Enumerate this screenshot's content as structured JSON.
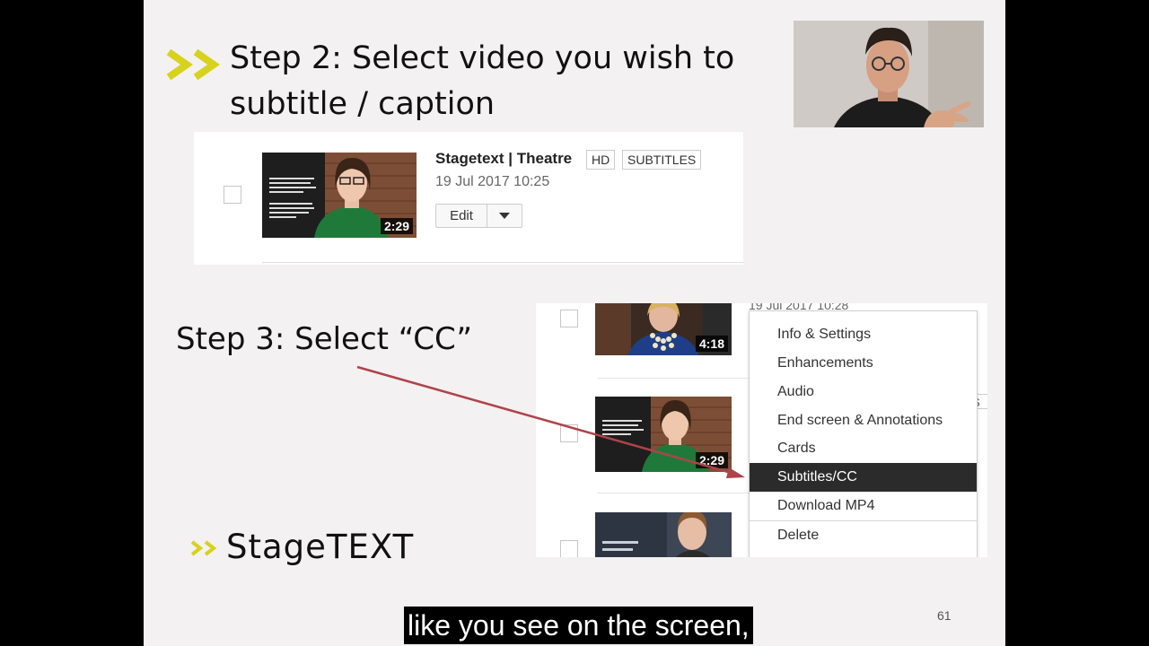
{
  "slide": {
    "step2_line1": "Step 2: Select video you wish to",
    "step2_line2": "subtitle / caption",
    "step3": "Step 3: Select “CC”",
    "page_number": "61",
    "logo_chevron": ">>",
    "logo_text": "StageTEXT"
  },
  "video_row": {
    "title": "Stagetext | Theatre",
    "badges": [
      "HD",
      "SUBTITLES"
    ],
    "date": "19 Jul 2017 10:25",
    "duration": "2:29",
    "edit_label": "Edit"
  },
  "video_list": {
    "clipped_date": "19 Jul 2017 10:28",
    "items": [
      {
        "duration": "4:18"
      },
      {
        "duration": "2:29"
      },
      {
        "duration": ""
      }
    ],
    "clipped_badge": "S"
  },
  "context_menu": {
    "items": [
      "Info & Settings",
      "Enhancements",
      "Audio",
      "End screen & Annotations",
      "Cards",
      "Subtitles/CC",
      "Download MP4",
      "Delete"
    ],
    "active_index": 5
  },
  "subtitle": "like you see on the screen,",
  "colors": {
    "accent": "#d7d21c",
    "arrow": "#b0424a",
    "slide_bg": "#f3f1f2",
    "menu_active": "#2b2b2b"
  }
}
